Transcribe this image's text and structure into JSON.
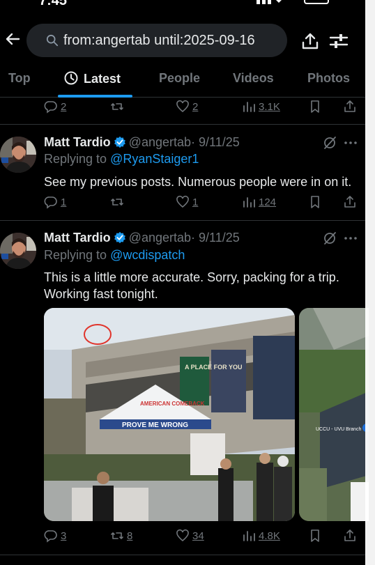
{
  "status": {
    "time": "7:45"
  },
  "search": {
    "query": "from:angertab until:2025-09-16"
  },
  "tabs": [
    {
      "label": "Top"
    },
    {
      "label": "Latest"
    },
    {
      "label": "People"
    },
    {
      "label": "Videos"
    },
    {
      "label": "Photos"
    }
  ],
  "prev_tweet_actions": {
    "replies": "2",
    "reposts": "",
    "likes": "2",
    "views": "3.1K"
  },
  "tweets": [
    {
      "name": "Matt Tardio",
      "handle": "@angertab",
      "date": "· 9/11/25",
      "replying_label": "Replying to ",
      "replying_to": "@RyanStaiger1",
      "text": "See my previous posts. Numerous people were in on it.",
      "actions": {
        "replies": "1",
        "reposts": "",
        "likes": "1",
        "views": "124"
      }
    },
    {
      "name": "Matt Tardio",
      "handle": "@angertab",
      "date": "· 9/11/25",
      "replying_label": "Replying to ",
      "replying_to": "@wcdispatch",
      "text": "This is a little more accurate. Sorry, packing for a trip. Working fast tonight.",
      "media": {
        "tent_banner": "PROVE ME WRONG",
        "tent_top": "AMERICAN COMEBACK",
        "poster_text": "A PLACE FOR YOU",
        "map_label": "UCCU - UVU Branch"
      },
      "actions": {
        "replies": "3",
        "reposts": "8",
        "likes": "34",
        "views": "4.8K"
      }
    }
  ],
  "colors": {
    "accent": "#1d9bf0",
    "muted": "#71767b",
    "text": "#e7e9ea",
    "bg": "#000000"
  }
}
